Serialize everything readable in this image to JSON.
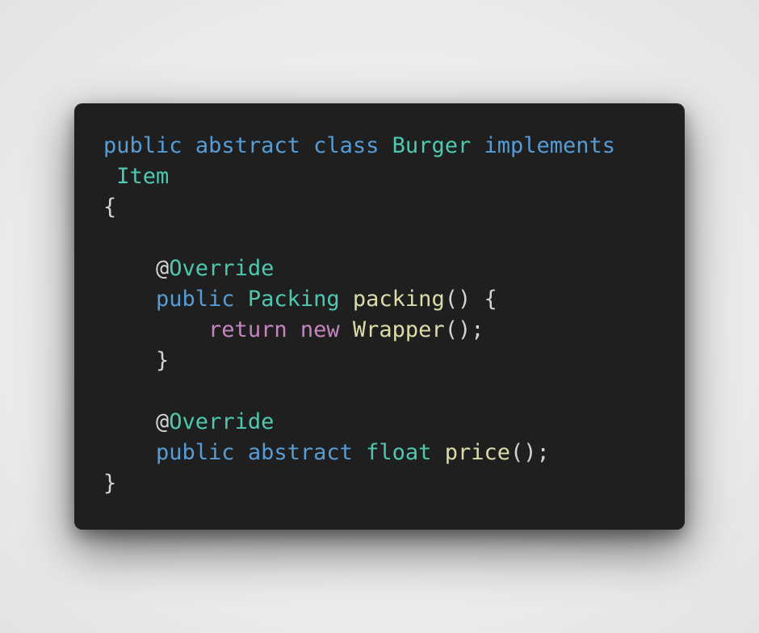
{
  "colors": {
    "background": "#ebebeb",
    "editor_background": "#1f1f1f",
    "keyword": "#569cd6",
    "type": "#4ec9b0",
    "control": "#c586c0",
    "function": "#dcdcaa",
    "punctuation": "#d4d4d4"
  },
  "code": {
    "line1": {
      "t1": "public",
      "t2": "abstract",
      "t3": "class",
      "t4": "Burger",
      "t5": "implements"
    },
    "line2": {
      "t1": "Item"
    },
    "line3": {
      "t1": "{"
    },
    "line5": {
      "t1": "@",
      "t2": "Override"
    },
    "line6": {
      "t1": "public",
      "t2": "Packing",
      "t3": "packing",
      "t4": "() {"
    },
    "line7": {
      "t1": "return",
      "t2": "new",
      "t3": "Wrapper",
      "t4": "();"
    },
    "line8": {
      "t1": "}"
    },
    "line10": {
      "t1": "@",
      "t2": "Override"
    },
    "line11": {
      "t1": "public",
      "t2": "abstract",
      "t3": "float",
      "t4": "price",
      "t5": "();"
    },
    "line12": {
      "t1": "}"
    }
  }
}
